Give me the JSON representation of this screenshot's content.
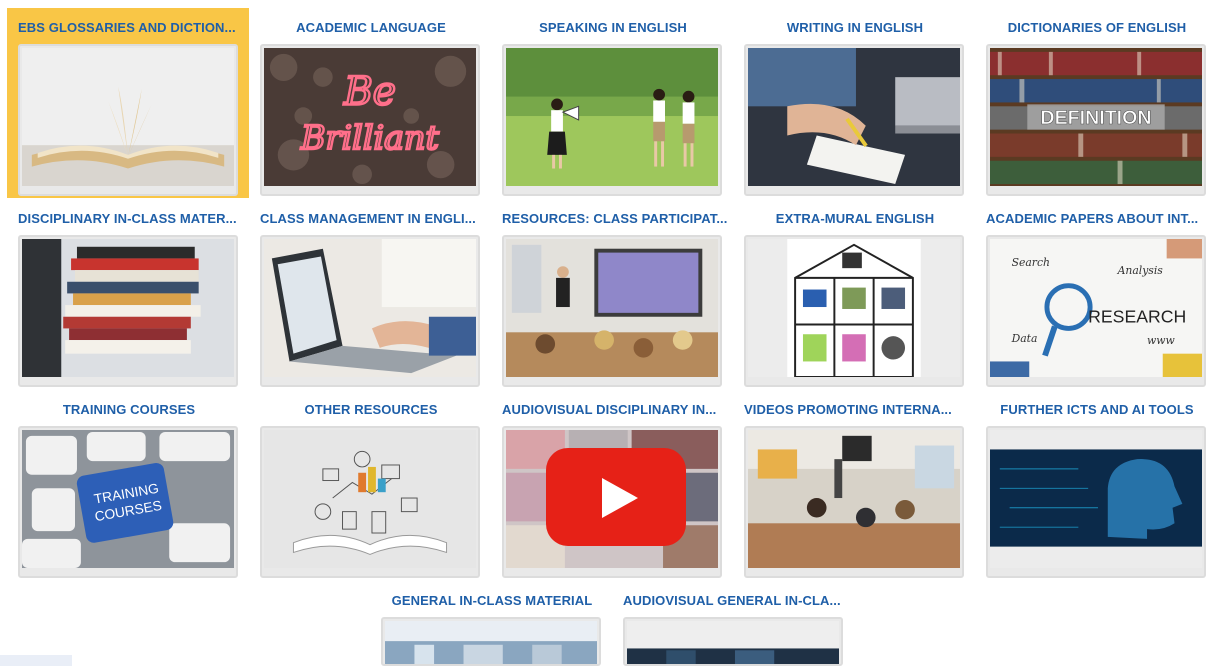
{
  "tiles": [
    {
      "title": "EBS GLOSSARIES AND DICTION...",
      "selected": true,
      "icon": "open-book-image"
    },
    {
      "title": "ACADEMIC LANGUAGE",
      "icon": "neon-sign-image"
    },
    {
      "title": "SPEAKING IN ENGLISH",
      "icon": "megaphone-image"
    },
    {
      "title": "WRITING IN ENGLISH",
      "icon": "hand-writing-image"
    },
    {
      "title": "DICTIONARIES OF ENGLISH",
      "icon": "bookshelf-image"
    },
    {
      "title": "DISCIPLINARY IN-CLASS MATER...",
      "icon": "book-stack-image"
    },
    {
      "title": "CLASS MANAGEMENT IN ENGLI...",
      "icon": "laptop-typing-image"
    },
    {
      "title": "RESOURCES: CLASS PARTICIPAT...",
      "icon": "classroom-image"
    },
    {
      "title": "EXTRA-MURAL ENGLISH",
      "icon": "house-diagram-image"
    },
    {
      "title": "ACADEMIC PAPERS ABOUT INT...",
      "icon": "research-sketch-image"
    },
    {
      "title": "TRAINING COURSES",
      "icon": "keyboard-key-image"
    },
    {
      "title": "OTHER RESOURCES",
      "icon": "book-drawing-image"
    },
    {
      "title": "AUDIOVISUAL DISCIPLINARY IN...",
      "icon": "youtube-play-image"
    },
    {
      "title": "VIDEOS PROMOTING INTERNA...",
      "icon": "classroom-photo-image"
    },
    {
      "title": "FURTHER ICTS AND AI TOOLS",
      "icon": "ai-head-image"
    },
    {
      "title": "GENERAL IN-CLASS MATERIAL",
      "icon": "partial-photo-image"
    },
    {
      "title": "AUDIOVISUAL GENERAL IN-CLA...",
      "icon": "partial-dark-image"
    }
  ],
  "keyboard_key_text": "TRAINING COURSES",
  "neon_text": "Be Brilliant",
  "shelf_text": "DEFINITION",
  "research_text": "RESEARCH",
  "research_words": [
    "Search",
    "Analysis",
    "Data",
    "www"
  ],
  "colors": {
    "title_blue": "#1f5fa8",
    "selected_bg": "#f9c646",
    "frame_border": "#dcdcdc"
  }
}
